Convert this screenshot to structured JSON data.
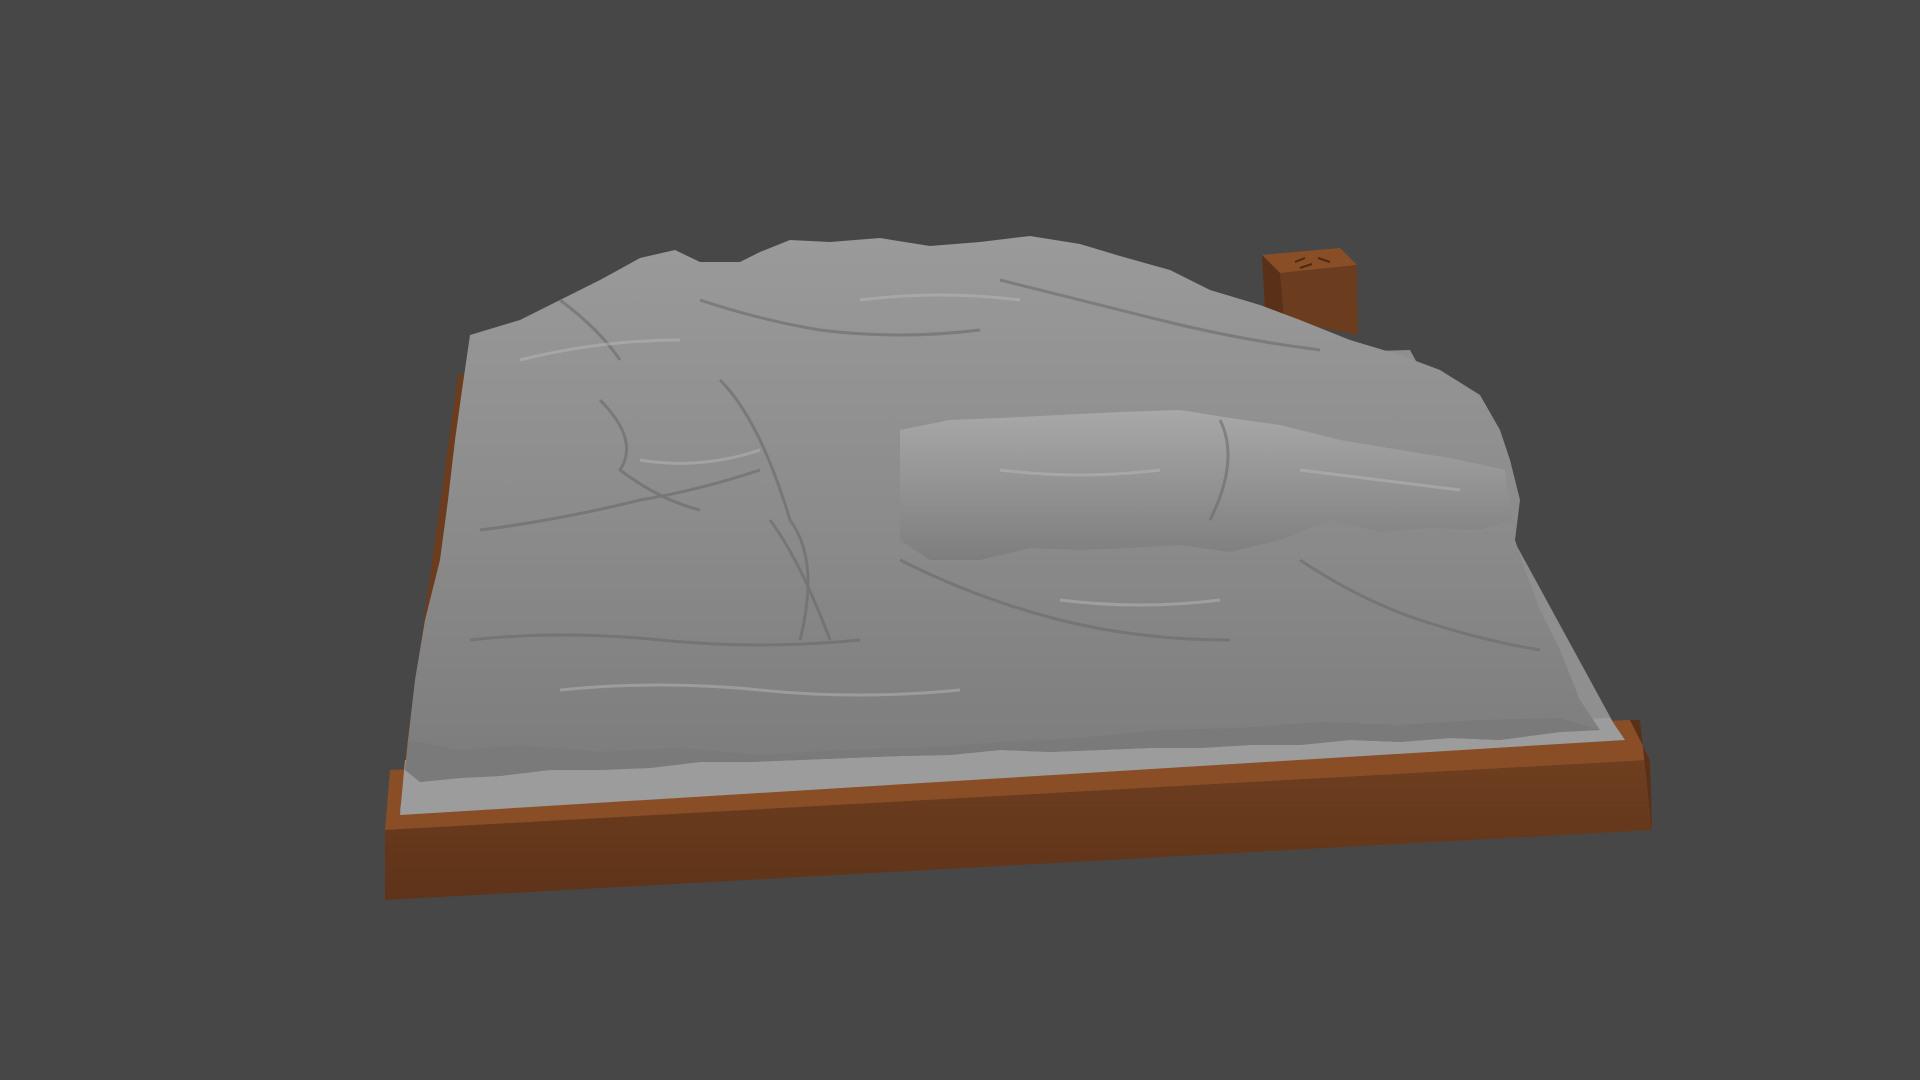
{
  "scene": {
    "subject": "terrain-relief-model",
    "colors": {
      "background": "#474747",
      "terrain": "#8e8e8e",
      "terrain_highlight": "#b4b4b4",
      "terrain_shadow": "#5e5e5e",
      "base_frame": "#6b3c1e",
      "base_frame_top": "#8a4e27",
      "base_plate": "#8f8f8f"
    },
    "icons": [
      "terrain-mesh",
      "wooden-base-frame",
      "label-block"
    ]
  }
}
